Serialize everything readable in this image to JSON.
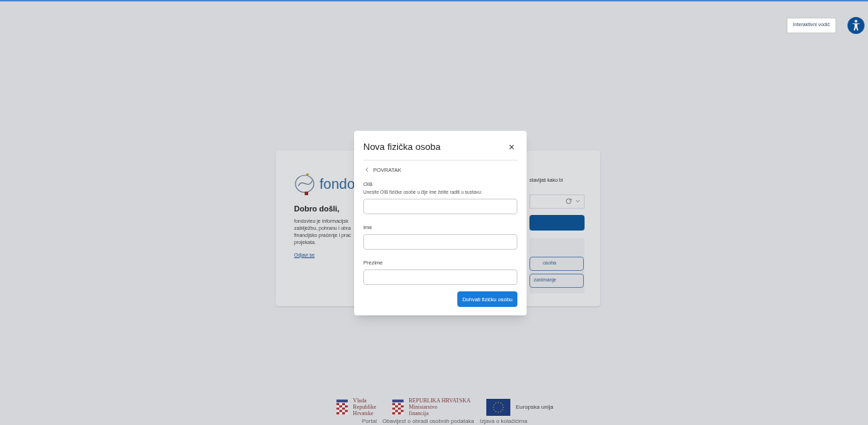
{
  "header": {
    "guide_button": "Interaktivni vodič"
  },
  "background_card": {
    "logo_text": "fondo",
    "welcome": "Dobro došli,",
    "description_lines": [
      "fondovieu je informacijsk",
      "zabilježbu, pohranu i obra",
      "financijsko praćenje i prac",
      "projekata."
    ],
    "logout_link": "Odjavi se",
    "right_text": "stavljaš kako bi",
    "right_buttons": [
      "osoba",
      "zanimanje"
    ]
  },
  "dialog": {
    "title": "Nova fizička osoba",
    "close": "×",
    "back": "POVRATAK",
    "fields": [
      {
        "label": "OIB",
        "hint": "Unesite OIB fizičke osobe u čije ime želite raditi u sustavu:"
      },
      {
        "label": "Ime"
      },
      {
        "label": "Prezime"
      }
    ],
    "submit": "Dohvati fizičku osobu"
  },
  "footer": {
    "logos": [
      {
        "kind": "crest",
        "lines": [
          "Vlada",
          "Republike",
          "Hrvatske"
        ]
      },
      {
        "kind": "crest",
        "lines": [
          "REPUBLIKA HRVATSKA",
          "Ministarstvo",
          "financija"
        ]
      },
      {
        "kind": "eu-flag",
        "lines": [
          "Europska unija"
        ]
      }
    ],
    "links": [
      "Portal",
      "Obavijest o obradi osobnih podataka",
      "Izjava o kolačićima"
    ]
  }
}
